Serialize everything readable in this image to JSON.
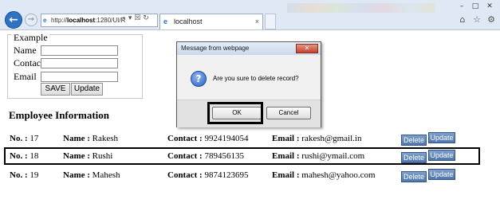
{
  "browser": {
    "address_scheme": "http://",
    "address_host": "localhost",
    "address_rest": ":1280/UI/R",
    "address_controls": "⌕ ▾ ☒ ↻",
    "tab_title": "localhost",
    "tab_close": "×"
  },
  "form": {
    "legend": "Example",
    "name_label": "Name",
    "contact_label": "Contact",
    "email_label": "Email",
    "name_value": "",
    "contact_value": "",
    "email_value": "",
    "save_label": "SAVE",
    "update_label": "Update"
  },
  "section_title": "Employee Information",
  "labels": {
    "no": "No. :",
    "name": "Name :",
    "contact": "Contact :",
    "email": "Email :",
    "delete": "Delete",
    "update": "Update"
  },
  "rows": [
    {
      "no": "17",
      "name": "Rakesh",
      "contact": "9924194054",
      "email": "rakesh@gmail.in"
    },
    {
      "no": "18",
      "name": "Rushi",
      "contact": "789456135",
      "email": "rushi@ymail.com"
    },
    {
      "no": "19",
      "name": "Mahesh",
      "contact": "9874123695",
      "email": "mahesh@yahoo.com"
    }
  ],
  "dialog": {
    "title": "Message from webpage",
    "message": "Are you sure to delete record?",
    "ok_label": "OK",
    "cancel_label": "Cancel",
    "close_glyph": "✕",
    "icon_glyph": "?"
  },
  "icons": {
    "back": "back-arrow-icon",
    "forward": "forward-arrow-icon",
    "page": "ie-page-icon",
    "question": "question-icon",
    "home": "home-icon",
    "favorites": "star-icon",
    "tools": "gear-icon"
  },
  "colors": {
    "chrome_bg": "#dfe9f5",
    "row_button": "#4f76ad",
    "back_button": "#2e72c6"
  }
}
